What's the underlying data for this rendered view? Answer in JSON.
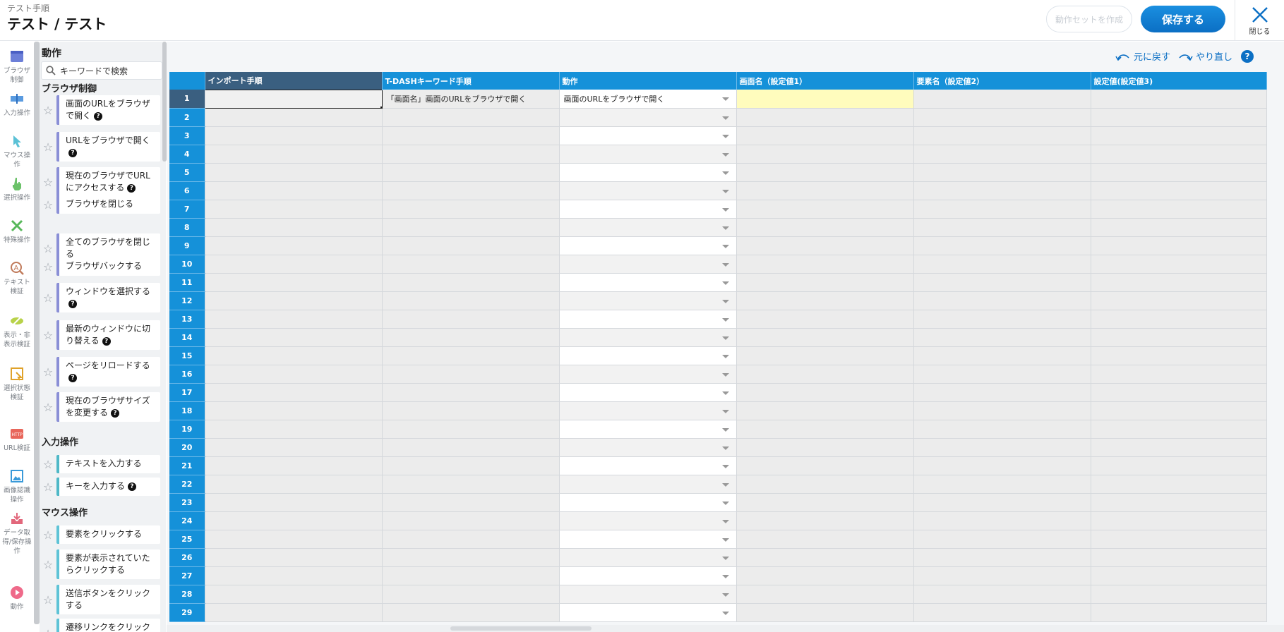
{
  "header": {
    "subtitle": "テスト手順",
    "title": "テスト / テスト",
    "create_set_label": "動作セットを作成",
    "save_label": "保存する",
    "close_label": "閉じる"
  },
  "rail": {
    "items": [
      {
        "label": "ブラウザ制御",
        "icon": "browser-icon"
      },
      {
        "label": "入力操作",
        "icon": "input-icon"
      },
      {
        "label": "マウス操作",
        "icon": "cursor-icon"
      },
      {
        "label": "選択操作",
        "icon": "hand-pointer-icon"
      },
      {
        "label": "特殊操作",
        "icon": "tools-icon"
      },
      {
        "label": "テキスト検証",
        "icon": "text-verify-icon"
      },
      {
        "label": "表示・非表示検証",
        "icon": "eye-slash-icon"
      },
      {
        "label": "選択状態検証",
        "icon": "selection-verify-icon"
      },
      {
        "label": "URL検証",
        "icon": "http-icon"
      },
      {
        "label": "画像認識操作",
        "icon": "image-icon"
      },
      {
        "label": "データ取得/保存操作",
        "icon": "download-tray-icon"
      },
      {
        "label": "動作",
        "icon": "play-icon"
      }
    ]
  },
  "palette": {
    "title": "動作",
    "search_placeholder": "キーワードで検索",
    "categories": [
      {
        "name": "ブラウザ制御",
        "actions": [
          {
            "label": "画面のURLをブラウザで開く",
            "help": true
          },
          {
            "label": "URLをブラウザで開く",
            "help": true
          },
          {
            "label": "現在のブラウザでURLにアクセスする",
            "help": true
          },
          {
            "label": "ブラウザを閉じる",
            "help": false
          },
          {
            "label": "全てのブラウザを閉じる",
            "help": false
          },
          {
            "label": "ブラウザバックする",
            "help": false
          },
          {
            "label": "ウィンドウを選択する",
            "help": true
          },
          {
            "label": "最新のウィンドウに切り替える",
            "help": true
          },
          {
            "label": "ページをリロードする",
            "help": true
          },
          {
            "label": "現在のブラウザサイズを変更する",
            "help": true
          }
        ]
      },
      {
        "name": "入力操作",
        "actions": [
          {
            "label": "テキストを入力する",
            "help": false
          },
          {
            "label": "キーを入力する",
            "help": true
          }
        ]
      },
      {
        "name": "マウス操作",
        "actions": [
          {
            "label": "要素をクリックする",
            "help": false
          },
          {
            "label": "要素が表示されていたらクリックする",
            "help": false
          },
          {
            "label": "送信ボタンをクリックする",
            "help": false
          },
          {
            "label": "遷移リンクをクリックす",
            "help": false
          }
        ]
      }
    ],
    "help_glyph": "?"
  },
  "toolbar": {
    "undo_label": "元に戻す",
    "redo_label": "やり直し",
    "help_glyph": "?"
  },
  "grid": {
    "columns": [
      "インポート手順",
      "T-DASHキーワード手順",
      "動作",
      "画面名（設定値1）",
      "要素名（設定値2）",
      "設定値(設定値3)"
    ],
    "rows": [
      {
        "no": "1",
        "import": "",
        "keyword": "「画面名」画面のURLをブラウザで開く",
        "action": "画面のURLをブラウザで開く"
      },
      {
        "no": "2"
      },
      {
        "no": "3"
      },
      {
        "no": "4"
      },
      {
        "no": "5"
      },
      {
        "no": "6"
      },
      {
        "no": "7"
      },
      {
        "no": "8"
      },
      {
        "no": "9"
      },
      {
        "no": "10"
      },
      {
        "no": "11"
      },
      {
        "no": "12"
      },
      {
        "no": "13"
      },
      {
        "no": "14"
      },
      {
        "no": "15"
      },
      {
        "no": "16"
      },
      {
        "no": "17"
      },
      {
        "no": "18"
      },
      {
        "no": "19"
      },
      {
        "no": "20"
      },
      {
        "no": "21"
      },
      {
        "no": "22"
      },
      {
        "no": "23"
      },
      {
        "no": "24"
      },
      {
        "no": "25"
      },
      {
        "no": "26"
      },
      {
        "no": "27"
      },
      {
        "no": "28"
      },
      {
        "no": "29"
      }
    ]
  },
  "colors": {
    "header_blue": "#1591d9",
    "import_header": "#3a5f80",
    "primary": "#0b6fc4",
    "highlight_yellow": "#fffcbd"
  }
}
